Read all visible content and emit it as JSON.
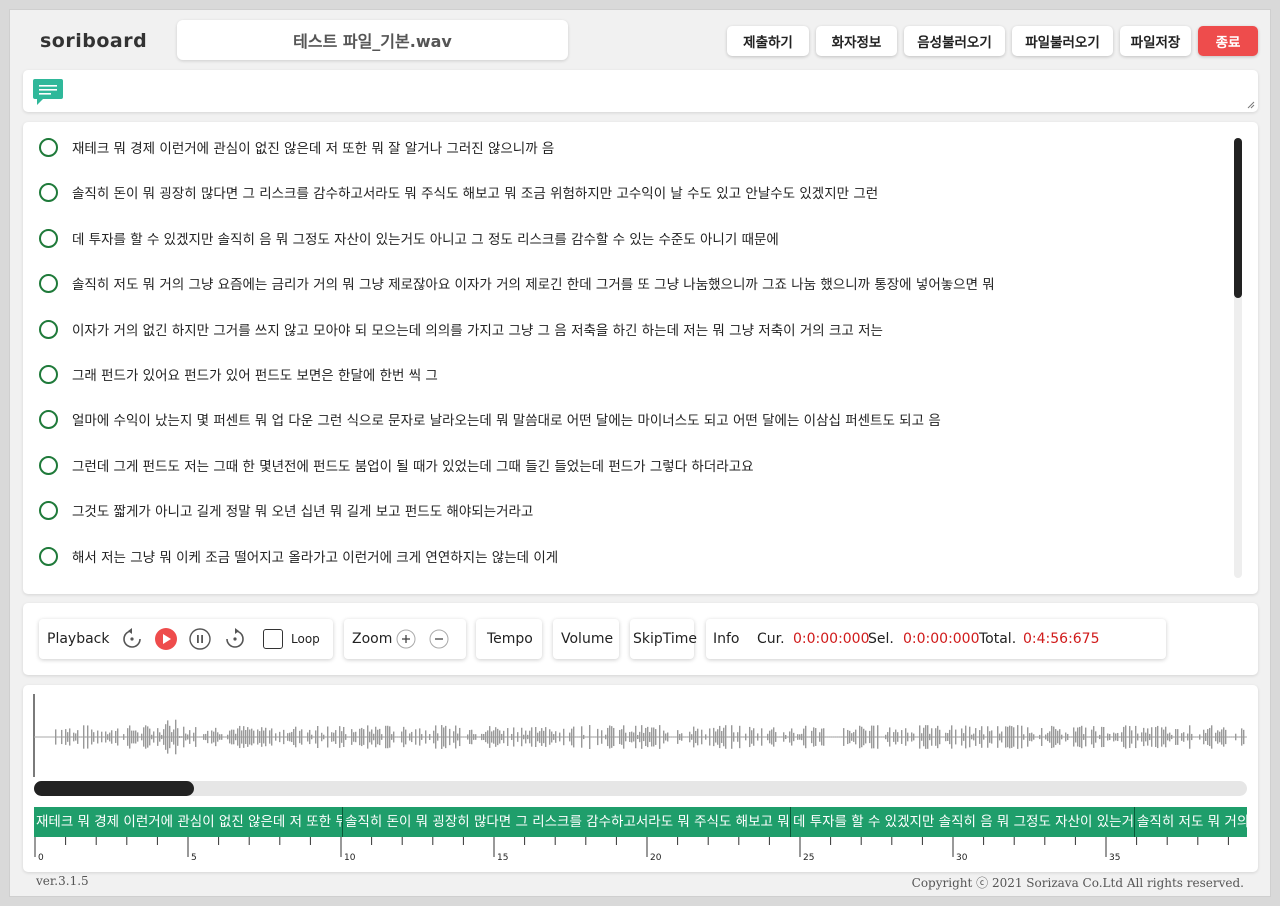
{
  "app": {
    "logo": "soriboard",
    "filename": "테스트 파일_기본.wav",
    "version": "ver.3.1.5",
    "copyright": "Copyright ⓒ 2021 Sorizava Co.Ltd All rights reserved."
  },
  "header_buttons": {
    "submit": "제출하기",
    "speaker_info": "화자정보",
    "load_audio": "음성불러오기",
    "load_file": "파일불러오기",
    "save_file": "파일저장",
    "exit": "종료"
  },
  "transcript": [
    "재테크 뭐 경제 이런거에 관심이 없진 않은데 저 또한 뭐 잘 알거나 그러진 않으니까 음",
    "솔직히 돈이 뭐 굉장히 많다면 그 리스크를 감수하고서라도 뭐 주식도 해보고 뭐 조금 위험하지만 고수익이 날 수도 있고 안날수도 있겠지만 그런",
    "데 투자를 할 수 있겠지만 솔직히 음 뭐 그정도 자산이 있는거도 아니고 그 정도 리스크를 감수할 수 있는 수준도 아니기 때문에",
    "솔직히 저도 뭐 거의 그냥 요즘에는 금리가 거의 뭐 그냥 제로잖아요 이자가 거의 제로긴 한데 그거를 또 그냥 나눔했으니까 그죠 나눔 했으니까 통장에 넣어놓으면 뭐",
    "이자가 거의 없긴 하지만 그거를 쓰지 않고 모아야 되 모으는데 의의를 가지고 그냥 그 음 저축을 하긴 하는데 저는 뭐 그냥 저축이 거의 크고 저는",
    "그래 펀드가 있어요 펀드가 있어 펀드도 보면은 한달에 한번 씩 그",
    "얼마에 수익이 났는지 몇 퍼센트 뭐 업 다운 그런 식으로 문자로 날라오는데 뭐 말씀대로 어떤 달에는 마이너스도 되고 어떤 달에는 이삼십 퍼센트도 되고 음",
    "그런데 그게 펀드도 저는 그때 한 몇년전에 펀드도 붐업이 될 때가 있었는데 그때 들긴 들었는데 펀드가 그렇다 하더라고요",
    "그것도 짧게가 아니고 길게 정말 뭐 오년 십년 뭐 길게 보고 펀드도 해야되는거라고",
    "해서 저는 그냥 뭐 이케 조금 떨어지고 올라가고 이런거에 크게 연연하지는 않는데 이게"
  ],
  "controls": {
    "playback_label": "Playback",
    "loop_label": "Loop",
    "loop_checked": false,
    "zoom_label": "Zoom",
    "tempo_label": "Tempo",
    "volume_label": "Volume",
    "skiptime_label": "SkipTime",
    "info_label": "Info",
    "cur_label": "Cur.",
    "cur_value": "0:0:00:000",
    "sel_label": "Sel.",
    "sel_value": "0:0:00:000",
    "total_label": "Total.",
    "total_value": "0:4:56:675"
  },
  "waveform": {
    "segments": [
      "재테크 뭐 경제 이런거에 관심이 없진 않은데 저 또한 뭐 잘 알거나 그러진 않으니까 음",
      "솔직히 돈이 뭐 굉장히 많다면 그 리스크를 감수하고서라도 뭐 주식도 해보고 뭐 조금 위험하지만",
      "데 투자를 할 수 있겠지만 솔직히 음 뭐 그정도 자산이 있는거도 아니고",
      "솔직히 저도 뭐 거의 그냥 요즘에는"
    ],
    "ruler_labels": [
      "0",
      "5",
      "10",
      "15",
      "20",
      "25",
      "30",
      "35"
    ]
  },
  "colors": {
    "accent_red": "#ee4c4c",
    "segment_green": "#1f9e6b",
    "circle_green": "#1f7a3a",
    "time_red": "#d01a1a"
  },
  "icons": {
    "memo": "chat-bubble-icon",
    "rewind": "rewind-icon",
    "play": "play-icon",
    "pause": "pause-icon",
    "forward": "forward-icon",
    "zoom_in": "zoom-in-icon",
    "zoom_out": "zoom-out-icon"
  }
}
